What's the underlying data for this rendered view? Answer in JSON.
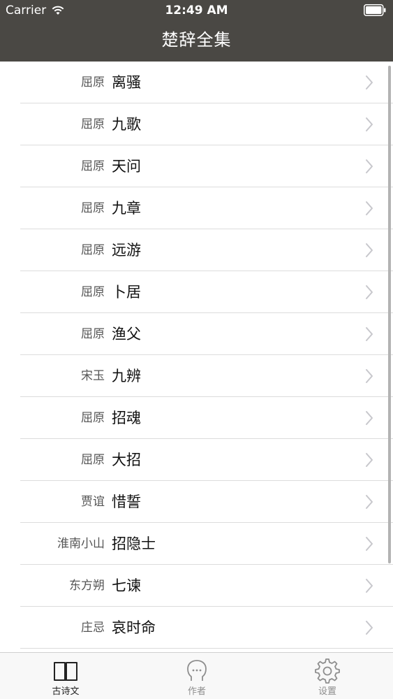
{
  "status_bar": {
    "carrier": "Carrier",
    "time": "12:49 AM"
  },
  "nav": {
    "title": "楚辞全集"
  },
  "poems": [
    {
      "author": "屈原",
      "title": "离骚"
    },
    {
      "author": "屈原",
      "title": "九歌"
    },
    {
      "author": "屈原",
      "title": "天问"
    },
    {
      "author": "屈原",
      "title": "九章"
    },
    {
      "author": "屈原",
      "title": "远游"
    },
    {
      "author": "屈原",
      "title": "卜居"
    },
    {
      "author": "屈原",
      "title": "渔父"
    },
    {
      "author": "宋玉",
      "title": "九辨"
    },
    {
      "author": "屈原",
      "title": "招魂"
    },
    {
      "author": "屈原",
      "title": "大招"
    },
    {
      "author": "贾谊",
      "title": "惜誓"
    },
    {
      "author": "淮南小山",
      "title": "招隐士"
    },
    {
      "author": "东方朔",
      "title": "七谏"
    },
    {
      "author": "庄忌",
      "title": "哀时命"
    }
  ],
  "tabbar": {
    "tabs": [
      {
        "label": "古诗文",
        "icon": "book-icon",
        "active": true
      },
      {
        "label": "作者",
        "icon": "person-icon",
        "active": false
      },
      {
        "label": "设置",
        "icon": "gear-icon",
        "active": false
      }
    ]
  },
  "colors": {
    "header_bg": "#4a4844",
    "divider": "#dcdcdc",
    "tab_active": "#222222",
    "tab_inactive": "#8e8e8e"
  }
}
